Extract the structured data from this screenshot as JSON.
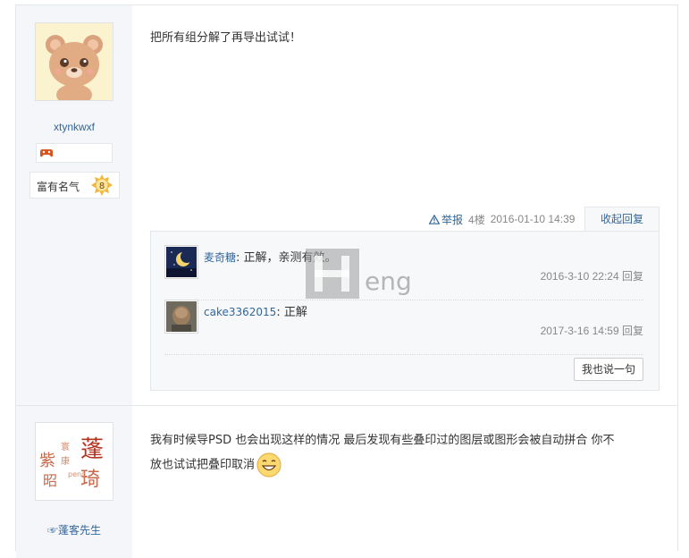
{
  "post1": {
    "user": {
      "name": "xtynkwxf",
      "title": "富有名气",
      "level": "8",
      "avatar": "bear-avatar"
    },
    "content": "把所有组分解了再导出试试！",
    "meta": {
      "report": "举报",
      "floor": "4楼",
      "time": "2016-01-10 14:39",
      "collapse": "收起回复"
    },
    "comments": [
      {
        "user": "麦奇糖",
        "text": ": 正解，亲测有效。",
        "time": "2016-3-10 22:24",
        "reply": "回复",
        "avatar": "moon-night-avatar"
      },
      {
        "user": "cake3362015",
        "text": ": 正解",
        "time": "2017-3-16 14:59",
        "reply": "回复",
        "avatar": "statue-avatar"
      }
    ],
    "reply_button": "我也说一句"
  },
  "post2": {
    "user": {
      "name": "蓬客先生",
      "prefix": "☞",
      "avatar": "calligraphy-avatar"
    },
    "content_line1": "我有时候导PSD 也会出现这样的情况 最后发现有些叠印过的图层或图形会被自动拼合 你不",
    "content_line2": "放也试试把叠印取消"
  },
  "watermark": "eng",
  "colors": {
    "link": "#336699",
    "sidebar_bg": "#f4f6f9",
    "border": "#e3e6ea"
  }
}
